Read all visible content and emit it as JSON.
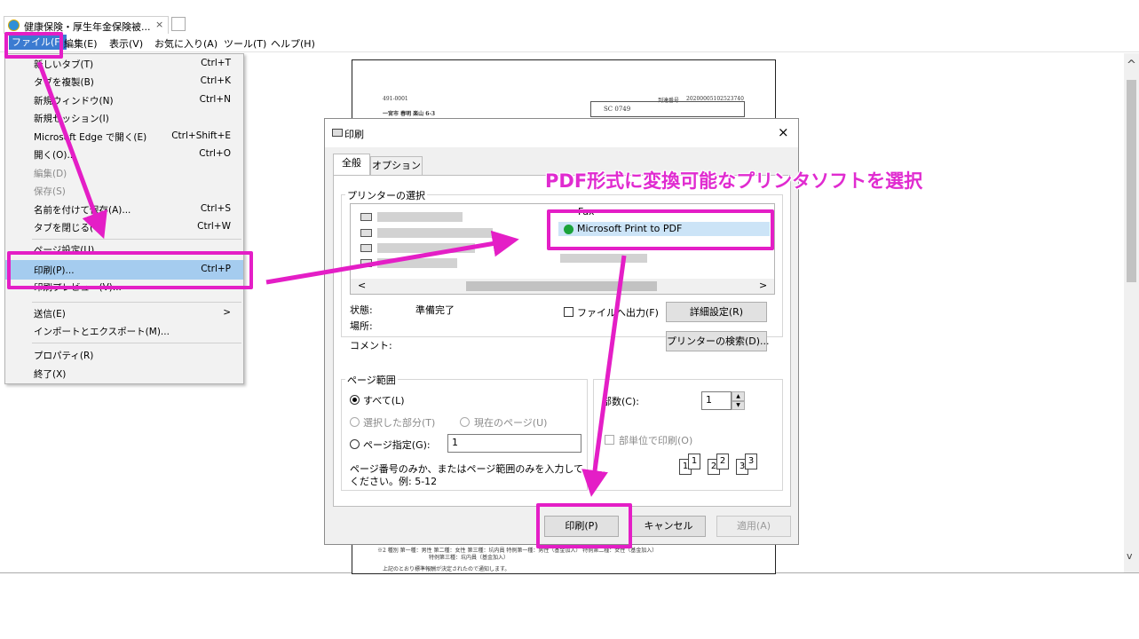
{
  "browser": {
    "tab_title": "健康保険・厚生年金保険被...",
    "tab_close": "×",
    "menu": [
      "ファイル(F)",
      "編集(E)",
      "表示(V)",
      "お気に入り(A)",
      "ツール(T)",
      "ヘルプ(H)"
    ]
  },
  "file_menu": {
    "items": [
      {
        "label": "新しいタブ(T)",
        "shortcut": "Ctrl+T"
      },
      {
        "label": "タブを複製(B)",
        "shortcut": "Ctrl+K"
      },
      {
        "label": "新規ウィンドウ(N)",
        "shortcut": "Ctrl+N"
      },
      {
        "label": "新規セッション(I)",
        "shortcut": ""
      },
      {
        "label": "Microsoft Edge で開く(E)",
        "shortcut": "Ctrl+Shift+E"
      },
      {
        "label": "開く(O)...",
        "shortcut": "Ctrl+O"
      },
      {
        "label": "編集(D)",
        "shortcut": ""
      },
      {
        "label": "保存(S)",
        "shortcut": ""
      },
      {
        "label": "名前を付けて保存(A)...",
        "shortcut": "Ctrl+S"
      },
      {
        "label": "タブを閉じる(C)",
        "shortcut": "Ctrl+W"
      },
      {
        "label": "ページ設定(U)...",
        "shortcut": ""
      },
      {
        "label": "印刷(P)...",
        "shortcut": "Ctrl+P"
      },
      {
        "label": "印刷プレビュー(V)...",
        "shortcut": ""
      },
      {
        "label": "送信(E)",
        "shortcut": ">"
      },
      {
        "label": "インポートとエクスポート(M)...",
        "shortcut": ""
      },
      {
        "label": "プロパティ(R)",
        "shortcut": ""
      },
      {
        "label": "終了(X)",
        "shortcut": ""
      }
    ]
  },
  "document": {
    "postal": "491-0001",
    "ref_label": "到達番号",
    "ref_number": "20200005102523740",
    "address": "一宮市 春明 楽山 6-3",
    "code": "SC 0749",
    "footnote_1": "※2 種別   第一種：男性  第二種：女性  第三種：坑内員  特例第一種：男性（基金加入）  特例第二種：女性（基金加入）",
    "footnote_2": "特例第三種：坑内員（基金加入）",
    "footnote_3": "上記のとおり標準報酬が決定されたので通知します。"
  },
  "print_dialog": {
    "title": "印刷",
    "close": "×",
    "tabs": [
      "全般",
      "オプション"
    ],
    "printer_group": "プリンターの選択",
    "printers_right": [
      "Fax",
      "Microsoft Print to PDF"
    ],
    "status_label": "状態:",
    "status_value": "準備完了",
    "location_label": "場所:",
    "comment_label": "コメント:",
    "print_to_file": "ファイルへ出力(F)",
    "details_button": "詳細設定(R)",
    "find_printer_button": "プリンターの検索(D)...",
    "page_range_group": "ページ範囲",
    "range_all": "すべて(L)",
    "range_selection": "選択した部分(T)",
    "range_current": "現在のページ(U)",
    "range_pages": "ページ指定(G):",
    "range_pages_value": "1",
    "range_hint_1": "ページ番号のみか、またはページ範囲のみを入力して",
    "range_hint_2": "ください。例: 5-12",
    "copies_label": "部数(C):",
    "copies_value": "1",
    "collate_label": "部単位で印刷(O)",
    "collate_nums": [
      "1",
      "1",
      "2",
      "2",
      "3",
      "3"
    ],
    "print_button": "印刷(P)",
    "cancel_button": "キャンセル",
    "apply_button": "適用(A)"
  },
  "annotation": {
    "text": "PDF形式に変換可能なプリンタソフトを選択",
    "color": "#e02bd0"
  },
  "scroll": {
    "up": "^",
    "down": "v"
  }
}
